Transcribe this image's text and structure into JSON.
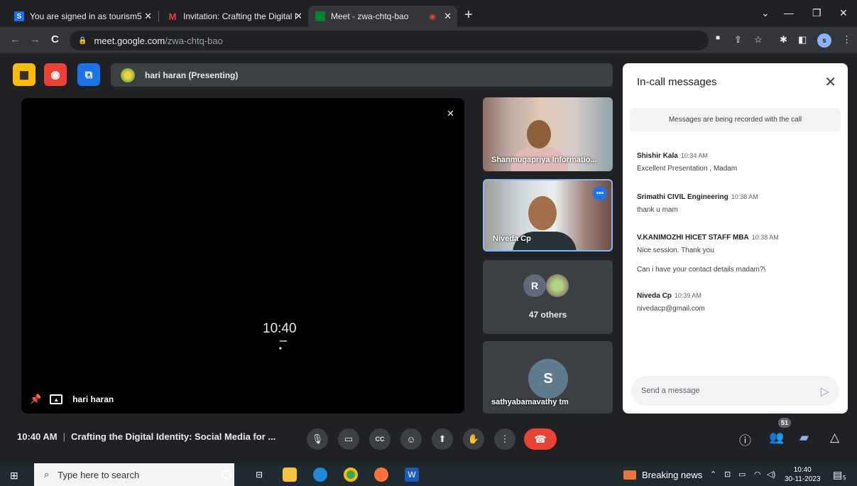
{
  "browser": {
    "tabs": [
      {
        "title": "You are signed in as tourism5",
        "favicon": "S",
        "favicon_color": "#1a73e8"
      },
      {
        "title": "Invitation: Crafting the Digital Id",
        "favicon": "M",
        "favicon_color": "#ea4335"
      },
      {
        "title": "Meet - zwa-chtq-bao",
        "favicon": "meet-icon",
        "favicon_color": "#00832d"
      }
    ],
    "address": {
      "host": "meet.google.com",
      "path": "/zwa-chtq-bao"
    },
    "profile_initial": "s"
  },
  "meet": {
    "presenting_label": "hari haran (Presenting)",
    "main_tile": {
      "name": "hari haran",
      "clock": "10:40"
    },
    "tiles": [
      {
        "name": "Shanmugapriya Informatio..."
      },
      {
        "name": "Niveda Cp"
      },
      {
        "name": "47 others",
        "avatar_initial": "R"
      },
      {
        "name": "sathyabamavathy tm",
        "avatar_initial": "S"
      }
    ],
    "bottom": {
      "time": "10:40 AM",
      "separator": "|",
      "meeting_title": "Crafting the Digital Identity: Social Media for ...",
      "participants_count": "51"
    }
  },
  "chat": {
    "title": "In-call messages",
    "notice": "Messages are being recorded with the call",
    "messages": [
      {
        "sender": "Shishir Kala",
        "time": "10:34 AM",
        "lines": [
          "Excellent Presentation , Madam"
        ]
      },
      {
        "sender": "Srimathi CIVIL Engineering",
        "time": "10:38 AM",
        "lines": [
          "thank u mam"
        ]
      },
      {
        "sender": "V.KANIMOZHI HICET STAFF MBA",
        "time": "10:38 AM",
        "lines": [
          "Nice session. Thank you",
          "Can i have your contact details madam?\\"
        ]
      },
      {
        "sender": "Niveda Cp",
        "time": "10:39 AM",
        "lines": [
          "nivedacp@gmail.com"
        ]
      }
    ],
    "input_placeholder": "Send a message"
  },
  "taskbar": {
    "search_placeholder": "Type here to search",
    "news_label": "Breaking news",
    "clock_time": "10:40",
    "clock_date": "30-11-2023",
    "notification_count": "5"
  }
}
